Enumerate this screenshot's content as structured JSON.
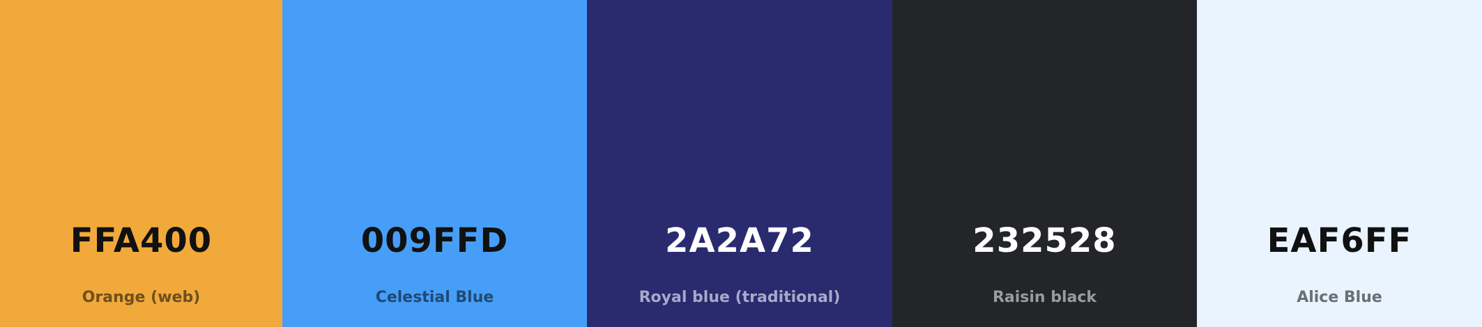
{
  "palette": {
    "swatches": [
      {
        "hex": "FFA400",
        "name": "Orange (web)",
        "color": "#f2a93b",
        "hex_color": "#111111",
        "name_color": "#6e4f1e"
      },
      {
        "hex": "009FFD",
        "name": "Celestial Blue",
        "color": "#479ef8",
        "hex_color": "#111111",
        "name_color": "#1f4a74"
      },
      {
        "hex": "2A2A72",
        "name": "Royal blue (traditional)",
        "color": "#2a2a6f",
        "hex_color": "#ffffff",
        "name_color": "#a9a9c9"
      },
      {
        "hex": "232528",
        "name": "Raisin black",
        "color": "#232528",
        "hex_color": "#ffffff",
        "name_color": "#9a9b9d"
      },
      {
        "hex": "EAF6FF",
        "name": "Alice Blue",
        "color": "#e9f4fe",
        "hex_color": "#111111",
        "name_color": "#6b6f73"
      }
    ]
  }
}
